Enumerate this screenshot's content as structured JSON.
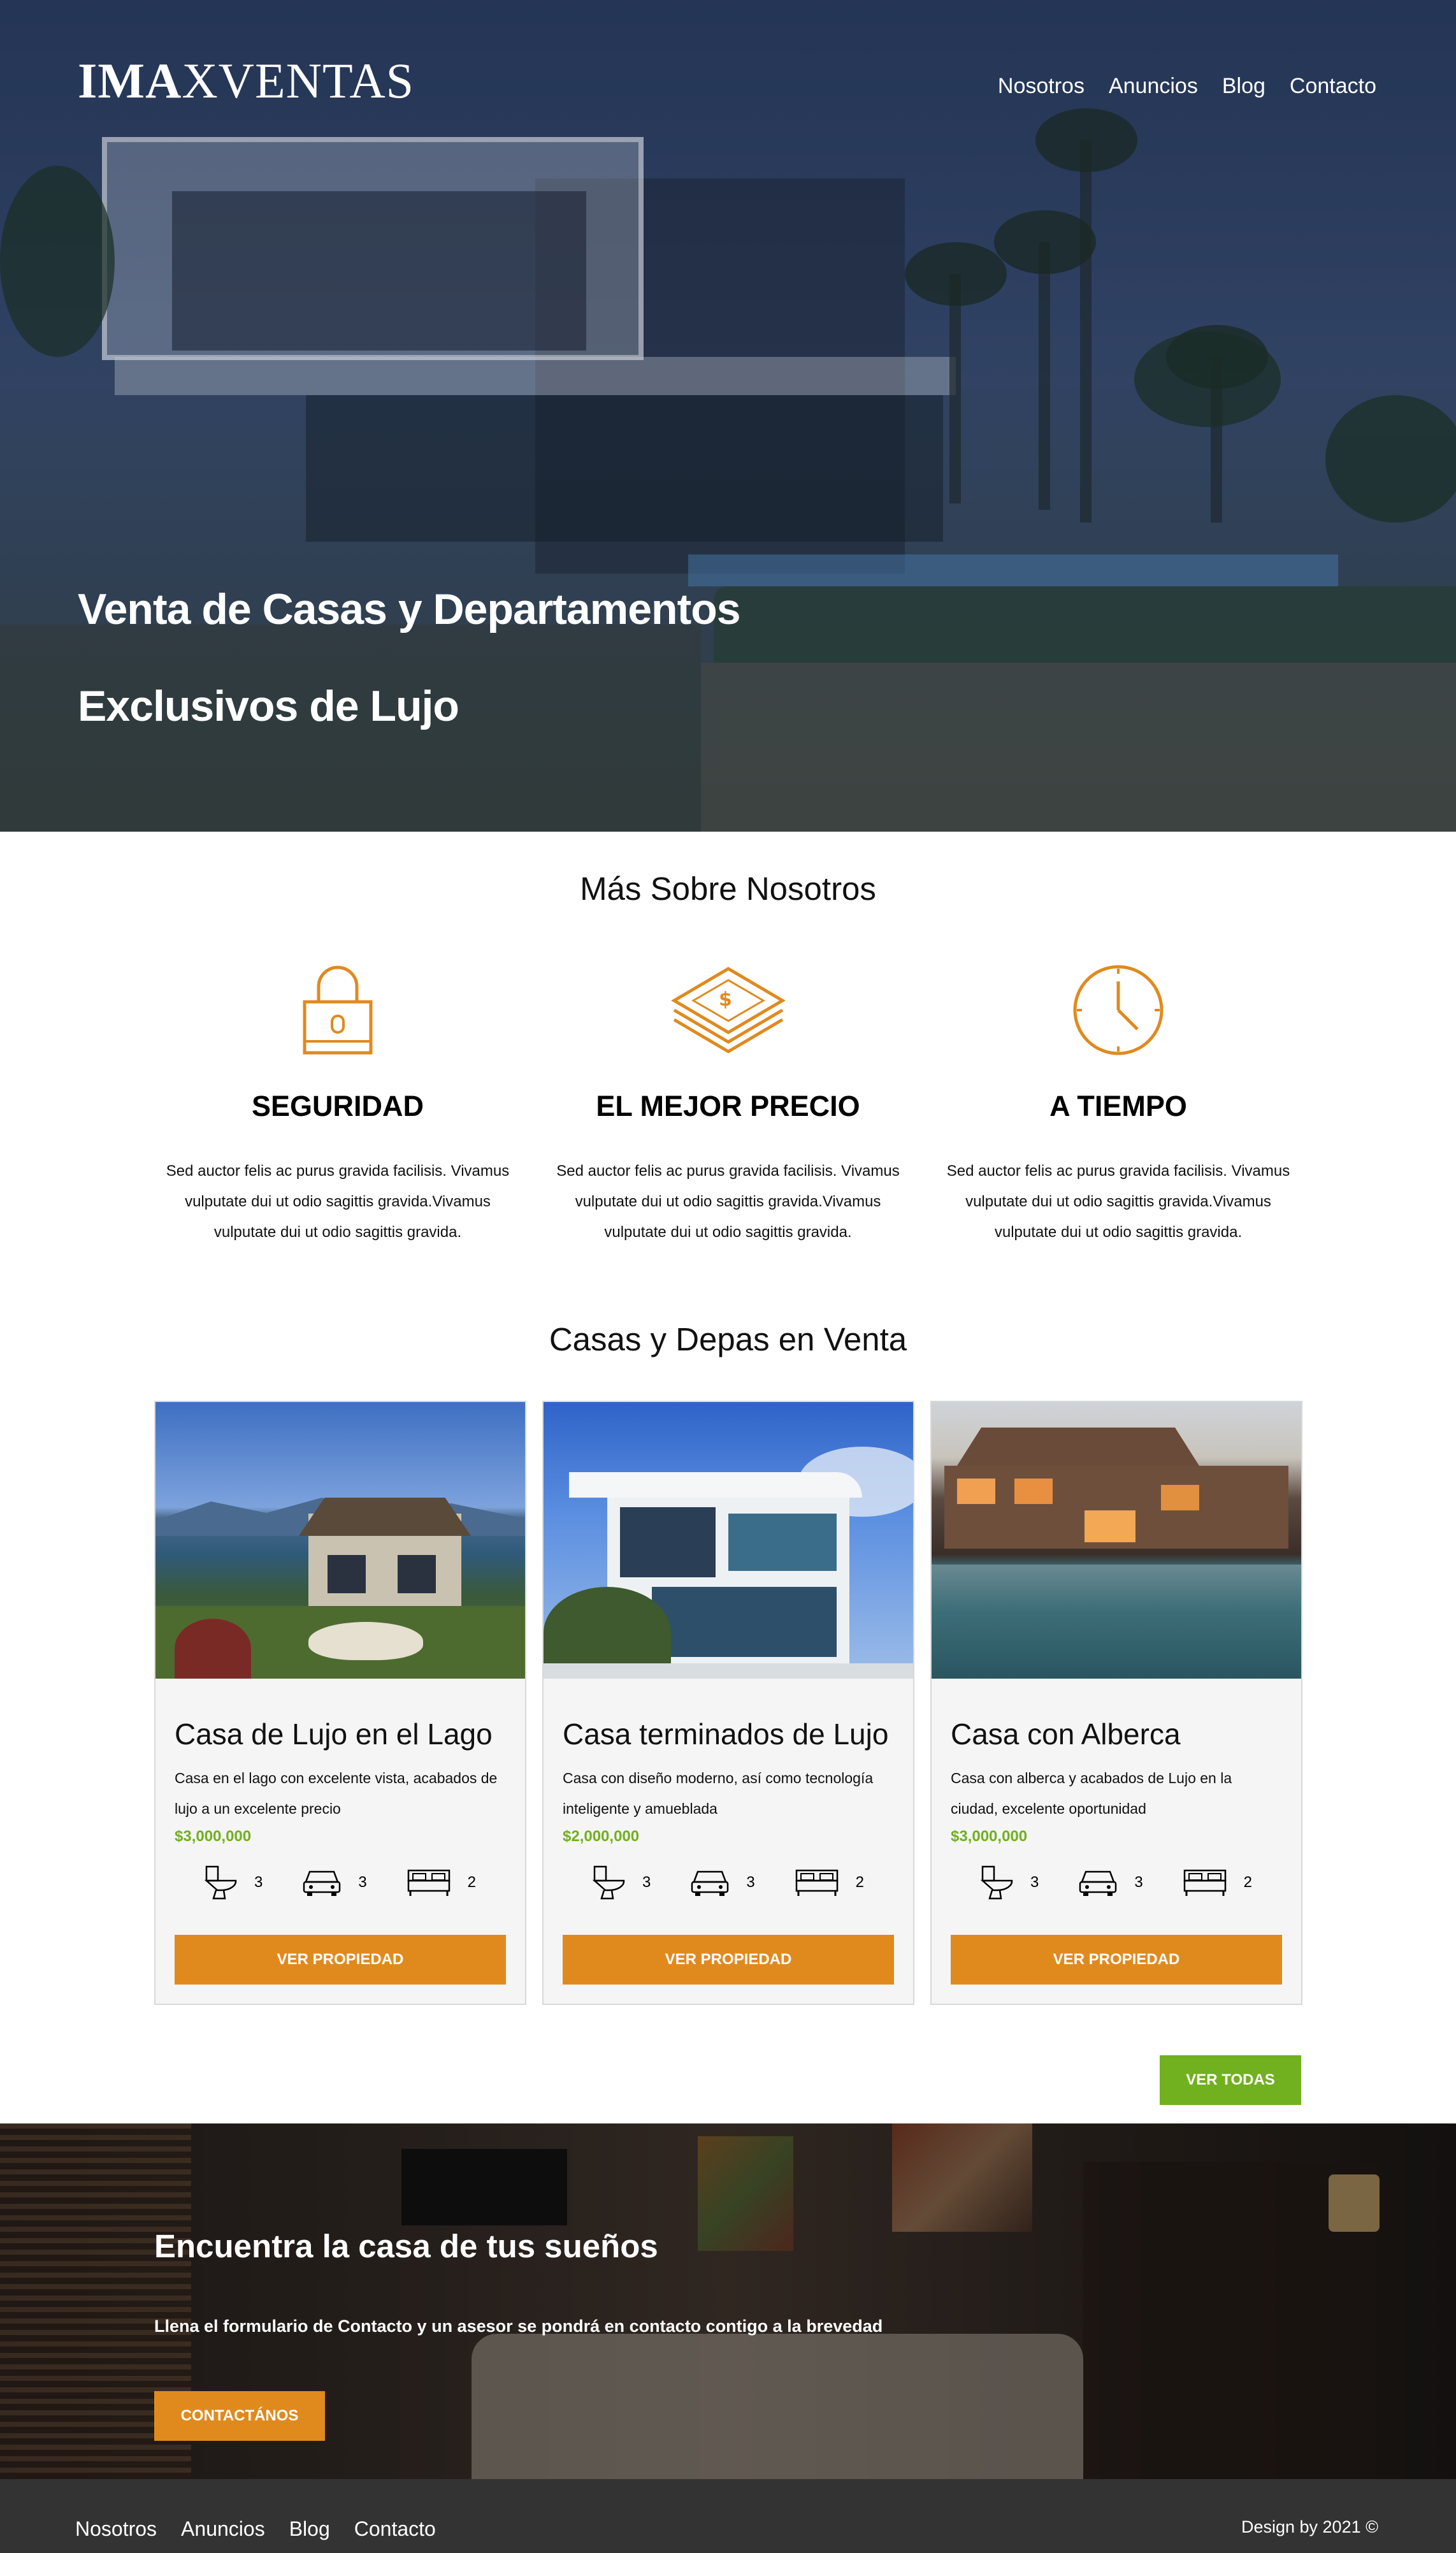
{
  "header": {
    "logo_bold": "IMA",
    "logo_regular": "XVENTAS",
    "nav": [
      "Nosotros",
      "Anuncios",
      "Blog",
      "Contacto"
    ]
  },
  "hero": {
    "line1": "Venta de Casas y Departamentos",
    "line2": "Exclusivos de Lujo"
  },
  "about": {
    "title": "Más Sobre Nosotros",
    "features": [
      {
        "icon": "lock-icon",
        "title": "SEGURIDAD",
        "text": "Sed auctor felis ac purus gravida facilisis. Vivamus vulputate dui ut odio sagittis gravida.Vivamus vulputate dui ut odio sagittis gravida."
      },
      {
        "icon": "money-icon",
        "title": "EL MEJOR PRECIO",
        "text": "Sed auctor felis ac purus gravida facilisis. Vivamus vulputate dui ut odio sagittis gravida.Vivamus vulputate dui ut odio sagittis gravida."
      },
      {
        "icon": "clock-icon",
        "title": "A TIEMPO",
        "text": "Sed auctor felis ac purus gravida facilisis. Vivamus vulputate dui ut odio sagittis gravida.Vivamus vulputate dui ut odio sagittis gravida."
      }
    ]
  },
  "listings": {
    "title": "Casas y Depas en Venta",
    "cards": [
      {
        "title": "Casa de Lujo en el Lago",
        "desc": "Casa en el lago con excelente vista, acabados de lujo a un excelente precio",
        "price": "$3,000,000",
        "baths": "3",
        "parking": "3",
        "beds": "2",
        "button": "VER PROPIEDAD"
      },
      {
        "title": "Casa terminados de Lujo",
        "desc": "Casa con diseño moderno, así como tecnología inteligente y amueblada",
        "price": "$2,000,000",
        "baths": "3",
        "parking": "3",
        "beds": "2",
        "button": "VER PROPIEDAD"
      },
      {
        "title": "Casa con Alberca",
        "desc": "Casa con alberca y acabados de Lujo en la ciudad, excelente oportunidad",
        "price": "$3,000,000",
        "baths": "3",
        "parking": "3",
        "beds": "2",
        "button": "VER PROPIEDAD"
      }
    ],
    "see_all": "VER TODAS"
  },
  "cta": {
    "title": "Encuentra la casa de tus sueños",
    "text": "Llena el formulario de Contacto y un asesor se pondrá en contacto contigo a la brevedad",
    "button": "CONTACTÁNOS"
  },
  "footer": {
    "nav": [
      "Nosotros",
      "Anuncios",
      "Blog",
      "Contacto"
    ],
    "credit": "Design by 2021 ©"
  },
  "colors": {
    "accent": "#e08a1e",
    "green": "#71b01f",
    "footer": "#333333"
  }
}
